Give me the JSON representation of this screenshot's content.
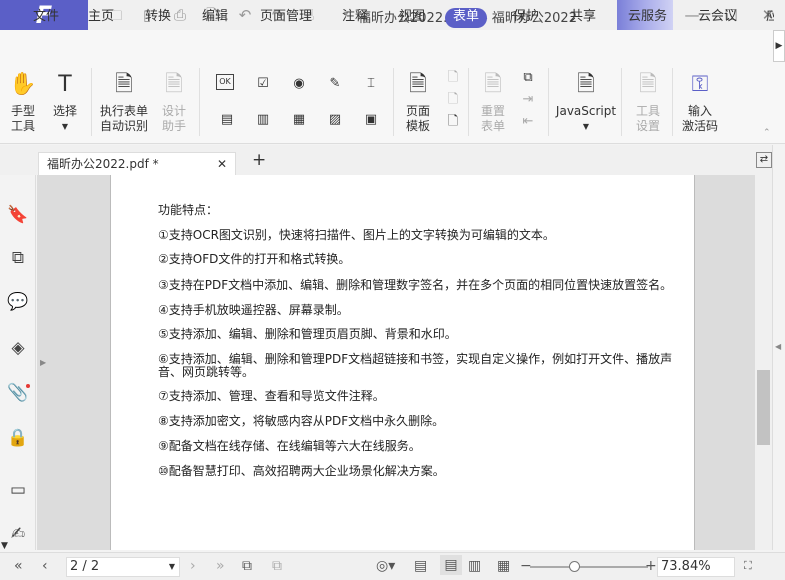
{
  "app": {
    "logo": "F",
    "title": "福昕办公2022.pdf * - 福昕办公2022",
    "accent": "#5b5fc7"
  },
  "quick_access": [
    "folder-icon",
    "save-icon",
    "print-icon",
    "new-file-icon",
    "undo-icon",
    "redo-icon",
    "hand-icon"
  ],
  "menu": [
    "文件",
    "主页",
    "转换",
    "编辑",
    "页面管理",
    "注释",
    "视图",
    "表单",
    "保护",
    "共享",
    "云服务",
    "云会议",
    "应"
  ],
  "menu_active": "表单",
  "ribbon": {
    "hand": {
      "l1": "手型",
      "l2": "工具"
    },
    "select": {
      "l1": "选择"
    },
    "auto_form": {
      "l1": "执行表单",
      "l2": "自动识别"
    },
    "design": {
      "l1": "设计",
      "l2": "助手"
    },
    "page_template": {
      "l1": "页面",
      "l2": "模板"
    },
    "reset": {
      "l1": "重置",
      "l2": "表单"
    },
    "javascript": {
      "l1": "JavaScript"
    },
    "tool_settings": {
      "l1": "工具",
      "l2": "设置"
    },
    "activate": {
      "l1": "输入",
      "l2": "激活码"
    },
    "ok_label": "OK"
  },
  "tab": {
    "name": "福昕办公2022.pdf *"
  },
  "document": {
    "heading": "功能特点：",
    "lines": [
      "①支持OCR图文识别，快速将扫描件、图片上的文字转换为可编辑的文本。",
      "②支持OFD文件的打开和格式转换。",
      "③支持在PDF文档中添加、编辑、删除和管理数字签名，并在多个页面的相同位置快速放置签名。",
      "④支持手机放映遥控器、屏幕录制。",
      "⑤支持添加、编辑、删除和管理页眉页脚、背景和水印。",
      "⑥支持添加、编辑、删除和管理PDF文档超链接和书签，实现自定义操作，例如打开文件、播放声音、网页跳转等。",
      "⑦支持添加、管理、查看和导览文件注释。",
      "⑧支持添加密文，将敏感内容从PDF文档中永久删除。",
      "⑨配备文档在线存储、在线编辑等六大在线服务。",
      "⑩配备智慧打印、高效招聘两大企业场景化解决方案。"
    ]
  },
  "status": {
    "page": "2 / 2",
    "zoom": "73.84%",
    "zoom_level_percent": 73.84
  }
}
